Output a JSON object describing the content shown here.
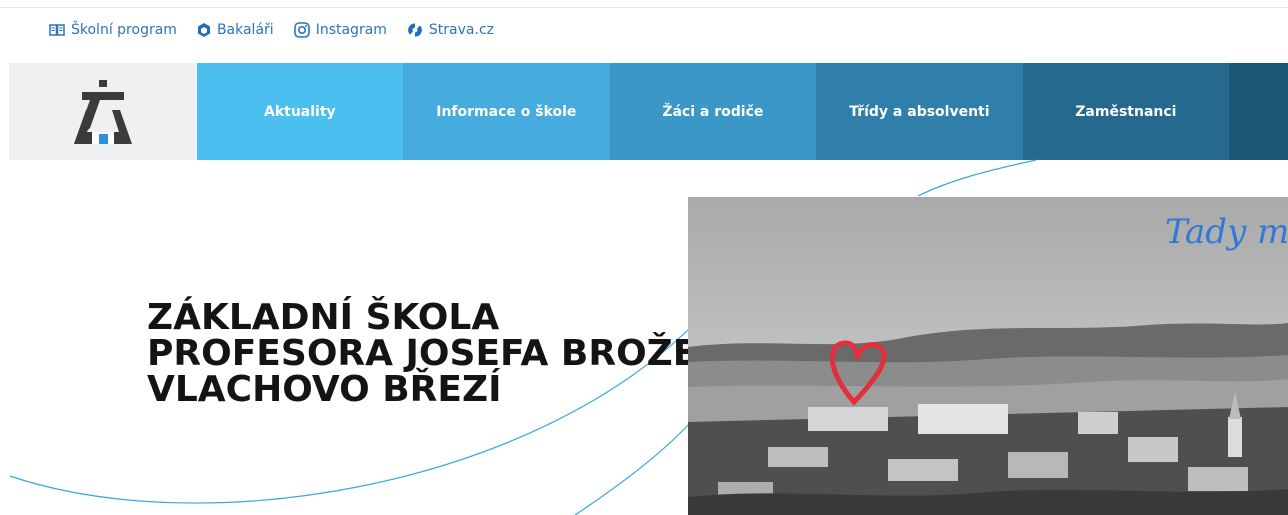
{
  "toplinks": {
    "items": [
      {
        "label": "Školní program",
        "icon": "book-icon"
      },
      {
        "label": "Bakaláři",
        "icon": "bakalari-logo-icon"
      },
      {
        "label": "Instagram",
        "icon": "instagram-icon"
      },
      {
        "label": "Strava.cz",
        "icon": "strava-logo-icon"
      }
    ]
  },
  "nav": {
    "items": [
      {
        "label": "Aktuality"
      },
      {
        "label": "Informace o škole"
      },
      {
        "label": "Žáci a rodiče"
      },
      {
        "label": "Třídy a absolventi"
      },
      {
        "label": "Zaměstnanci"
      },
      {
        "label": ""
      }
    ]
  },
  "hero": {
    "title_lines": [
      "ZÁKLADNÍ ŠKOLA",
      "PROFESORA JOSEFA BROŽE",
      "VLACHOVO BŘEZÍ"
    ],
    "photo_text": "Tady ma"
  },
  "colors": {
    "link": "#2a75ba",
    "nav": [
      "#4cbff1",
      "#45acdd",
      "#3b97c7",
      "#307fab",
      "#25698f",
      "#1c5876"
    ],
    "accent_square": "#2d8fe0",
    "heart": "#e2303b",
    "curve": "#3aa6e2"
  }
}
